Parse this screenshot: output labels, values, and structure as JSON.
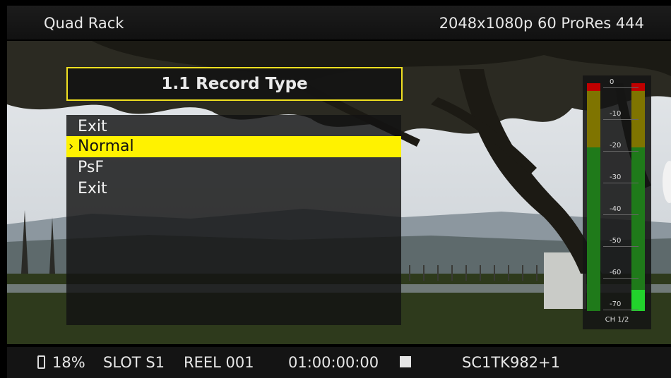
{
  "topbar": {
    "title": "Quad Rack",
    "format": "2048x1080p 60 ProRes 444"
  },
  "menu": {
    "title": "1.1 Record Type",
    "items": [
      {
        "label": "Exit",
        "selected": false
      },
      {
        "label": "Normal",
        "selected": true
      },
      {
        "label": "PsF",
        "selected": false
      },
      {
        "label": "Exit",
        "selected": false
      }
    ],
    "selection_marker": "›"
  },
  "audio_meter": {
    "channel_label": "CH 1/2",
    "scale": [
      "0",
      "-10",
      "-20",
      "-30",
      "-40",
      "-50",
      "-60",
      "-70"
    ],
    "colors": {
      "red": "#c00000",
      "yellow": "#7f7400",
      "green": "#1f7a1a",
      "peak_green": "#22d22c"
    }
  },
  "status": {
    "battery": "18%",
    "slot": "SLOT S1",
    "reel": "REEL 001",
    "timecode": "01:00:00:00",
    "clip": "SC1TK982+1"
  }
}
